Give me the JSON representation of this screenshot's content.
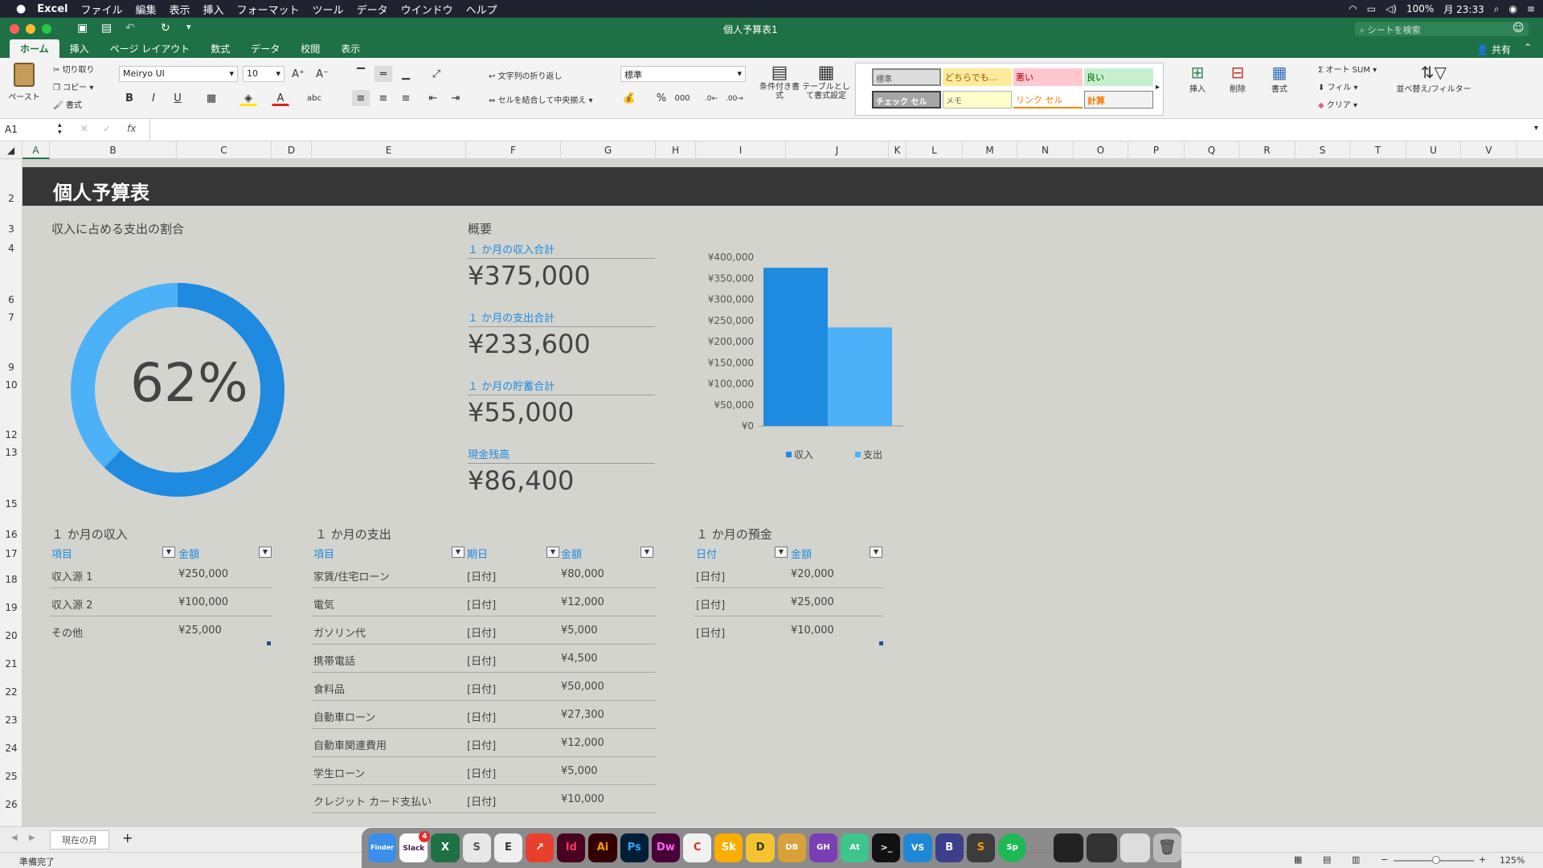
{
  "menubar": {
    "app": "Excel",
    "items": [
      "ファイル",
      "編集",
      "表示",
      "挿入",
      "フォーマット",
      "ツール",
      "データ",
      "ウインドウ",
      "ヘルプ"
    ],
    "battery": "100%",
    "clock": "月 23:33"
  },
  "titlebar": {
    "title": "個人予算表1",
    "search_placeholder": "シートを検索"
  },
  "ribbon_tabs": [
    "ホーム",
    "挿入",
    "ページ レイアウト",
    "数式",
    "データ",
    "校閲",
    "表示"
  ],
  "share": "共有",
  "ribbon": {
    "paste": "ペースト",
    "cut": "切り取り",
    "copy": "コピー",
    "format_painter": "書式",
    "font_name": "Meiryo UI",
    "font_size": "10",
    "bold": "B",
    "italic": "I",
    "underline": "U",
    "wrap_text": "文字列の折り返し",
    "merge_center": "セルを結合して中央揃え",
    "number_format": "標準",
    "conditional_format": "条件付き書式",
    "format_as_table": "テーブルとして書式設定",
    "styles": {
      "normal": "標準",
      "neutral": "どちらでも...",
      "bad": "悪い",
      "good": "良い",
      "check": "チェック セル",
      "memo": "メモ",
      "link": "リンク セル",
      "calc": "計算"
    },
    "insert": "挿入",
    "delete": "削除",
    "format": "書式",
    "autosum": "オート SUM",
    "fill": "フィル",
    "clear": "クリア",
    "sort_filter": "並べ替え/フィルター"
  },
  "formula": {
    "cell_ref": "A1",
    "fx": "fx",
    "value": ""
  },
  "columns": [
    "A",
    "B",
    "C",
    "D",
    "E",
    "F",
    "G",
    "H",
    "I",
    "J",
    "K",
    "L",
    "M",
    "N",
    "O",
    "P",
    "Q",
    "R",
    "S",
    "T",
    "U",
    "V"
  ],
  "rows": [
    "2",
    "3",
    "4",
    "6",
    "7",
    "9",
    "10",
    "12",
    "13",
    "15",
    "16",
    "17",
    "18",
    "19",
    "20",
    "21",
    "22",
    "23",
    "24",
    "25",
    "26"
  ],
  "banner_title": "個人予算表",
  "donut": {
    "title": "収入に占める支出の割合",
    "percent_label": "62%",
    "percent": 0.62,
    "colors": [
      "#1f8be0",
      "#4db1f7"
    ]
  },
  "summary": {
    "title": "概要",
    "items": [
      {
        "label": "１ か月の収入合計",
        "value": "¥375,000"
      },
      {
        "label": "１ か月の支出合計",
        "value": "¥233,600"
      },
      {
        "label": "１ か月の貯蓄合計",
        "value": "¥55,000"
      },
      {
        "label": "現金残高",
        "value": "¥86,400"
      }
    ]
  },
  "chart_data": {
    "type": "bar",
    "categories": [
      ""
    ],
    "series": [
      {
        "name": "収入",
        "values": [
          375000
        ],
        "color": "#1f8be0"
      },
      {
        "name": "支出",
        "values": [
          233600
        ],
        "color": "#4db1f7"
      }
    ],
    "ylim": [
      0,
      400000
    ],
    "yticks": [
      "¥400,000",
      "¥350,000",
      "¥300,000",
      "¥250,000",
      "¥200,000",
      "¥150,000",
      "¥100,000",
      "¥50,000",
      "¥0"
    ],
    "legend": "bottom"
  },
  "income": {
    "title": "１ か月の収入",
    "headers": [
      "項目",
      "金額"
    ],
    "rows": [
      [
        "収入源 1",
        "¥250,000"
      ],
      [
        "収入源 2",
        "¥100,000"
      ],
      [
        "その他",
        "¥25,000"
      ]
    ]
  },
  "expenses": {
    "title": "１ か月の支出",
    "headers": [
      "項目",
      "期日",
      "金額"
    ],
    "rows": [
      [
        "家賃/住宅ローン",
        "[日付]",
        "¥80,000"
      ],
      [
        "電気",
        "[日付]",
        "¥12,000"
      ],
      [
        "ガソリン代",
        "[日付]",
        "¥5,000"
      ],
      [
        "携帯電話",
        "[日付]",
        "¥4,500"
      ],
      [
        "食料品",
        "[日付]",
        "¥50,000"
      ],
      [
        "自動車ローン",
        "[日付]",
        "¥27,300"
      ],
      [
        "自動車関連費用",
        "[日付]",
        "¥12,000"
      ],
      [
        "学生ローン",
        "[日付]",
        "¥5,000"
      ],
      [
        "クレジット カード支払い",
        "[日付]",
        "¥10,000"
      ]
    ]
  },
  "savings": {
    "title": "１ か月の預金",
    "headers": [
      "日付",
      "金額"
    ],
    "rows": [
      [
        "[日付]",
        "¥20,000"
      ],
      [
        "[日付]",
        "¥25,000"
      ],
      [
        "[日付]",
        "¥10,000"
      ]
    ]
  },
  "sheet_tab": "現在の月",
  "status": {
    "ready": "準備完了",
    "zoom": "125%"
  },
  "dock": [
    "Finder",
    "Slack",
    "X",
    "S",
    "E",
    "↗",
    "Id",
    "Ai",
    "Ps",
    "Dw",
    "C",
    "Sk",
    "D",
    "DB",
    "GH",
    "At",
    ">_",
    "VS",
    "B",
    "S",
    "Sp"
  ],
  "dock_badge": "4"
}
